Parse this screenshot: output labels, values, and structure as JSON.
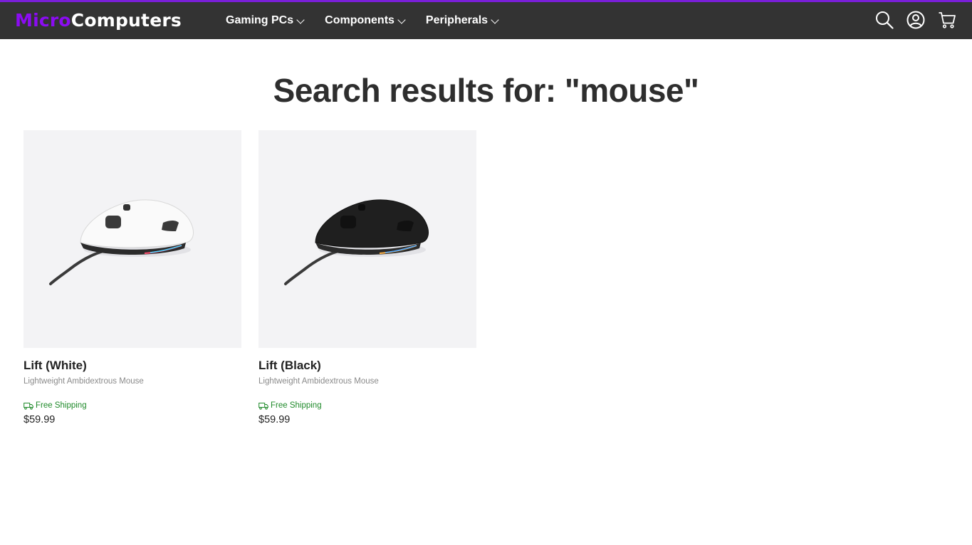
{
  "header": {
    "logo_part1": "Micro",
    "logo_part2": "Computers",
    "nav": [
      {
        "label": "Gaming PCs"
      },
      {
        "label": "Components"
      },
      {
        "label": "Peripherals"
      }
    ],
    "icons": [
      "search-icon",
      "account-icon",
      "cart-icon"
    ],
    "accent": "#8b0cf2",
    "bar_color": "#333333"
  },
  "search": {
    "heading": "Search results for: \"mouse\""
  },
  "products": [
    {
      "name": "Lift (White)",
      "subtitle": "Lightweight Ambidextrous Mouse",
      "shipping": "Free Shipping",
      "price": "$59.99",
      "color": "white"
    },
    {
      "name": "Lift (Black)",
      "subtitle": "Lightweight Ambidextrous Mouse",
      "shipping": "Free Shipping",
      "price": "$59.99",
      "color": "black"
    }
  ]
}
